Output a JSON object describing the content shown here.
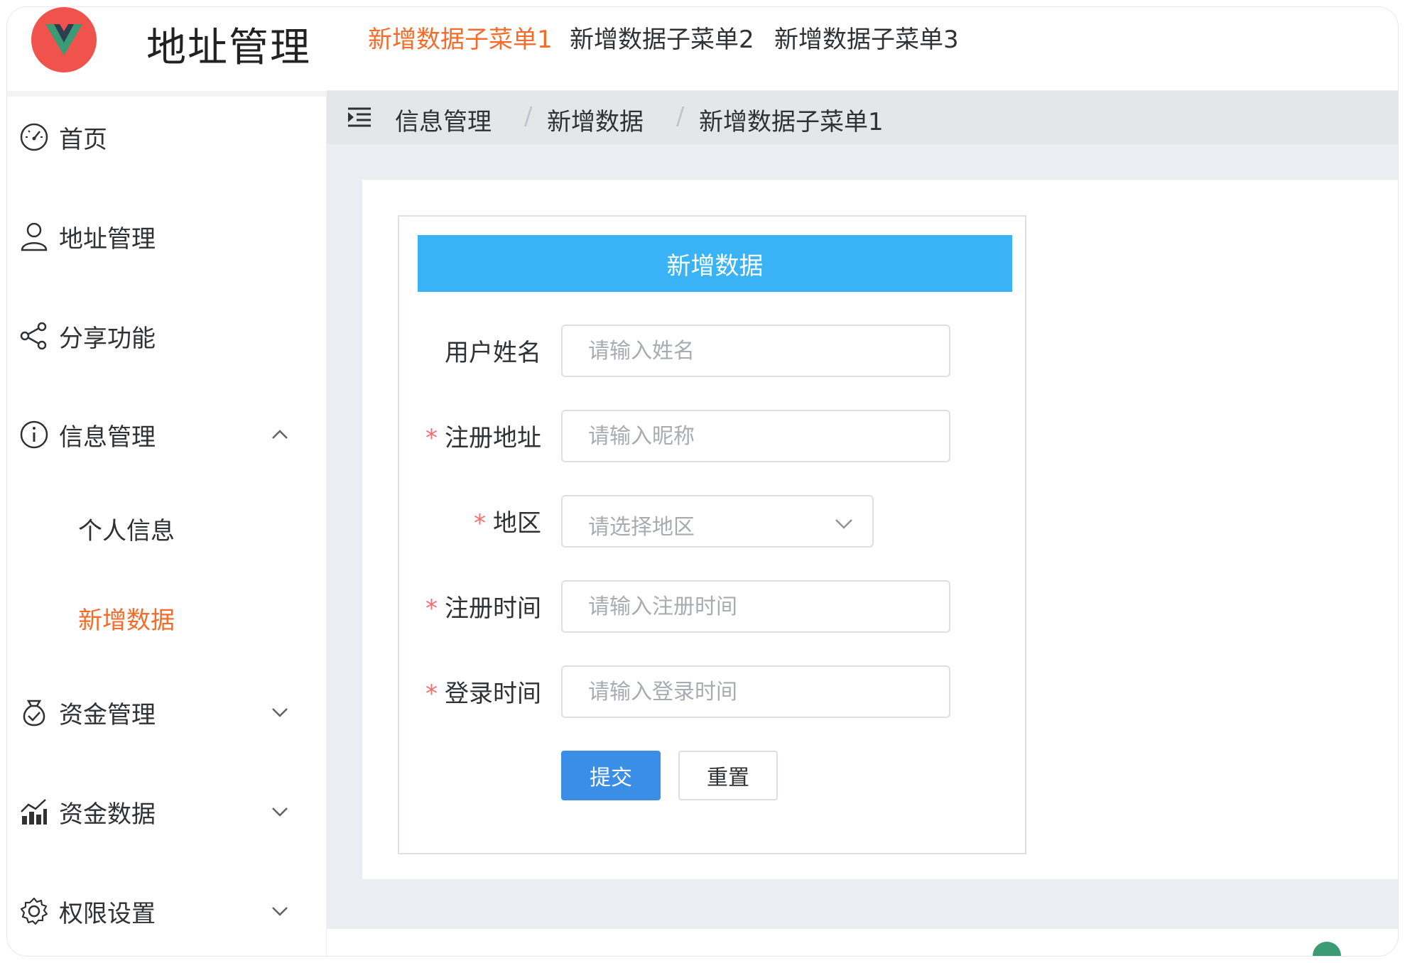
{
  "app": {
    "title": "地址管理",
    "brand_color": "#f0524c",
    "accent_color": "#f56c2a"
  },
  "topnav": {
    "items": [
      {
        "label": "新增数据子菜单1",
        "active": true
      },
      {
        "label": "新增数据子菜单2",
        "active": false
      },
      {
        "label": "新增数据子菜单3",
        "active": false
      }
    ]
  },
  "sidebar": {
    "items": [
      {
        "label": "首页",
        "icon": "dashboard-icon"
      },
      {
        "label": "地址管理",
        "icon": "user-icon"
      },
      {
        "label": "分享功能",
        "icon": "share-icon"
      },
      {
        "label": "信息管理",
        "icon": "info-icon",
        "expanded": true
      },
      {
        "label": "资金管理",
        "icon": "money-bag-icon",
        "expanded": false
      },
      {
        "label": "资金数据",
        "icon": "data-chart-icon",
        "expanded": false
      },
      {
        "label": "权限设置",
        "icon": "gear-icon",
        "expanded": false
      }
    ],
    "subitems": [
      {
        "label": "个人信息",
        "active": false
      },
      {
        "label": "新增数据",
        "active": true
      }
    ]
  },
  "breadcrumb": {
    "items": [
      "信息管理",
      "新增数据",
      "新增数据子菜单1"
    ],
    "separator": "/"
  },
  "form": {
    "header": "新增数据",
    "header_color": "#3ab3f6",
    "fields": {
      "name": {
        "label": "用户姓名",
        "required": false,
        "placeholder": "请输入姓名",
        "value": ""
      },
      "address": {
        "label": "注册地址",
        "required": true,
        "placeholder": "请输入昵称",
        "value": ""
      },
      "region": {
        "label": "地区",
        "required": true,
        "placeholder": "请选择地区",
        "value": ""
      },
      "reg_time": {
        "label": "注册时间",
        "required": true,
        "placeholder": "请输入注册时间",
        "value": ""
      },
      "login_time": {
        "label": "登录时间",
        "required": true,
        "placeholder": "请输入登录时间",
        "value": ""
      }
    },
    "required_mark": "*",
    "submit_label": "提交",
    "reset_label": "重置",
    "primary_color": "#3a8ee6"
  }
}
